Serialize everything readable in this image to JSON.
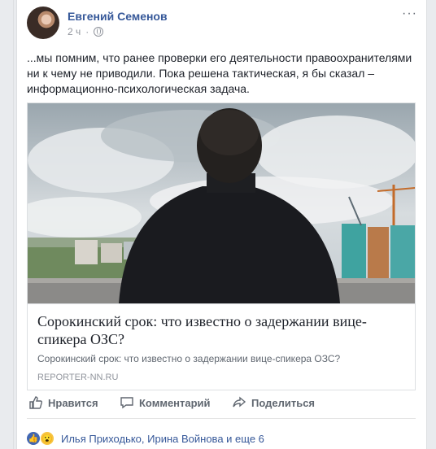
{
  "post": {
    "author": "Евгений Семенов",
    "time": "2 ч",
    "more_label": "···",
    "text": "...мы помним, что ранее проверки его деятельности правоохранителями ни к чему не приводили. Пока решена тактическая, я бы сказал – информационно-психологическая задача."
  },
  "link": {
    "title": "Сорокинский срок: что известно о задержании вице-спикера ОЗС?",
    "description": "Сорокинский срок: что известно о задержании вице-спикера ОЗС?",
    "domain": "REPORTER-NN.RU"
  },
  "actions": {
    "like": "Нравится",
    "comment": "Комментарий",
    "share": "Поделиться"
  },
  "reactions": {
    "names": "Илья Приходько, Ирина Войнова и еще 6"
  },
  "icons": {
    "like": "thumbs-up-icon",
    "comment": "comment-icon",
    "share": "share-icon",
    "privacy": "globe-icon"
  },
  "colors": {
    "link_blue": "#365899",
    "text": "#1d2129",
    "muted": "#90949c",
    "like_reaction": "#4267b2",
    "wow_reaction": "#f7c541"
  }
}
